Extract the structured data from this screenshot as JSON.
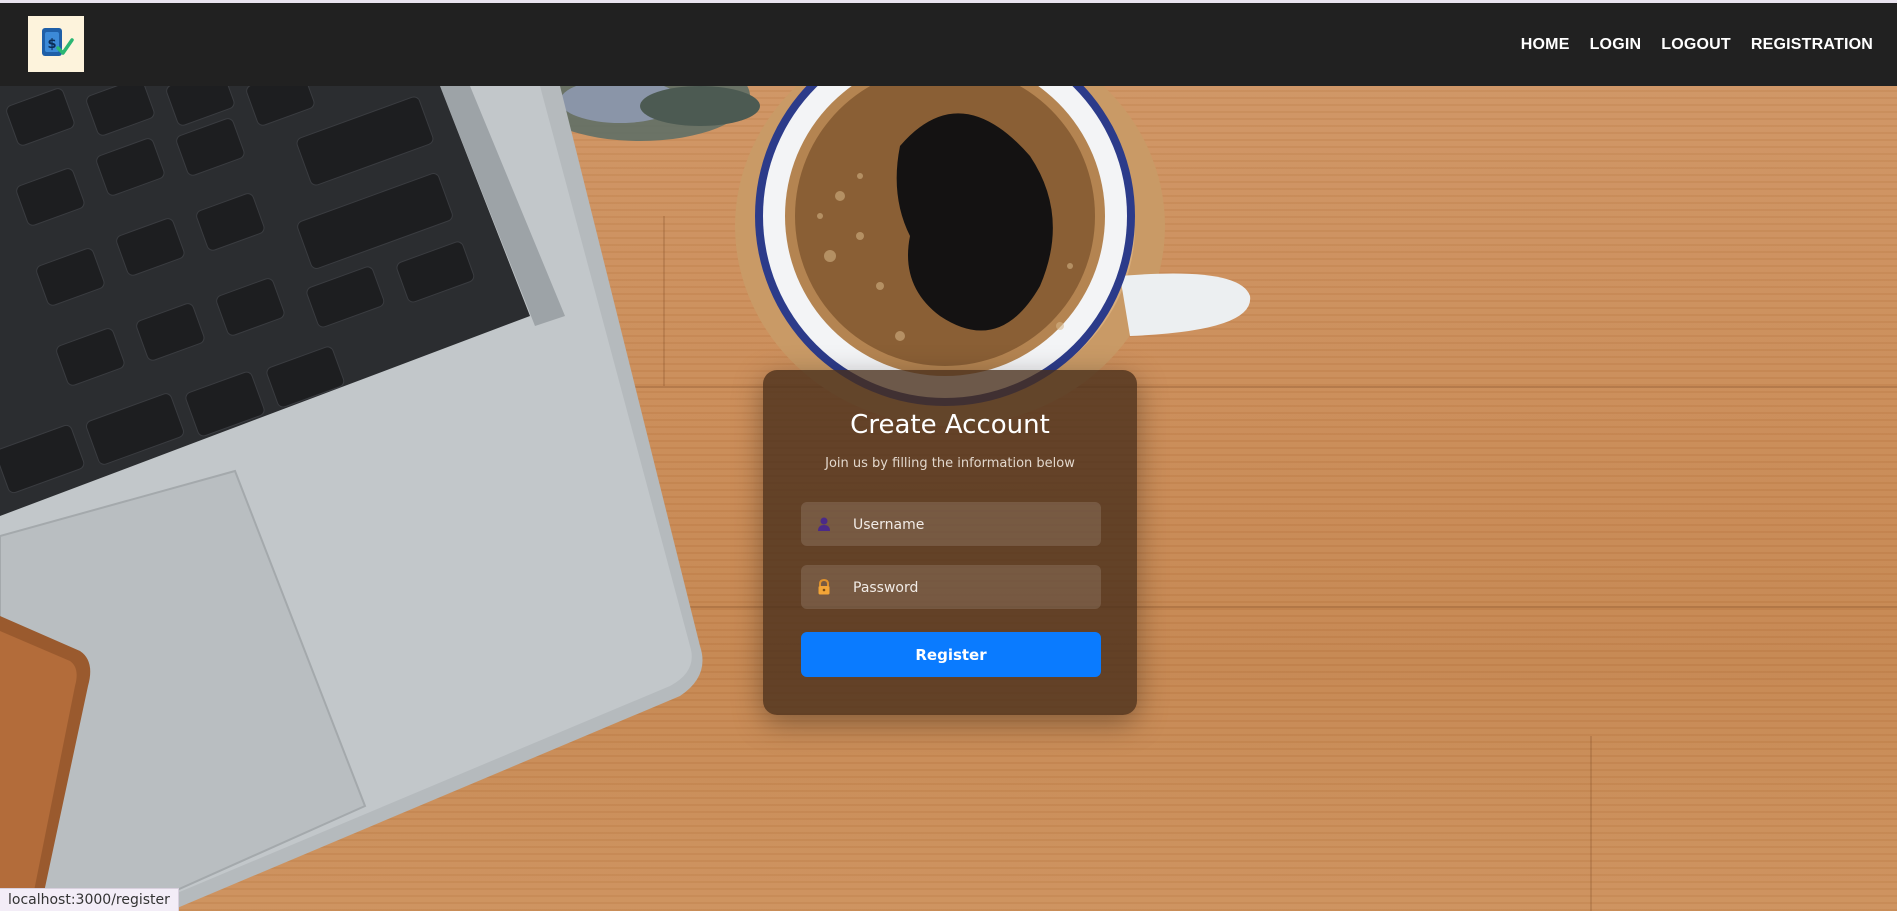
{
  "nav": {
    "logo_icon": "finance-check-logo",
    "links": [
      "HOME",
      "LOGIN",
      "LOGOUT",
      "REGISTRATION"
    ]
  },
  "form": {
    "title": "Create Account",
    "subtitle": "Join us by filling the information below",
    "username_placeholder": "Username",
    "password_placeholder": "Password",
    "username_icon": "user-icon",
    "password_icon": "lock-icon",
    "submit_label": "Register",
    "button_color": "#0a7bff"
  },
  "status_bar": {
    "url": "localhost:3000/register"
  }
}
